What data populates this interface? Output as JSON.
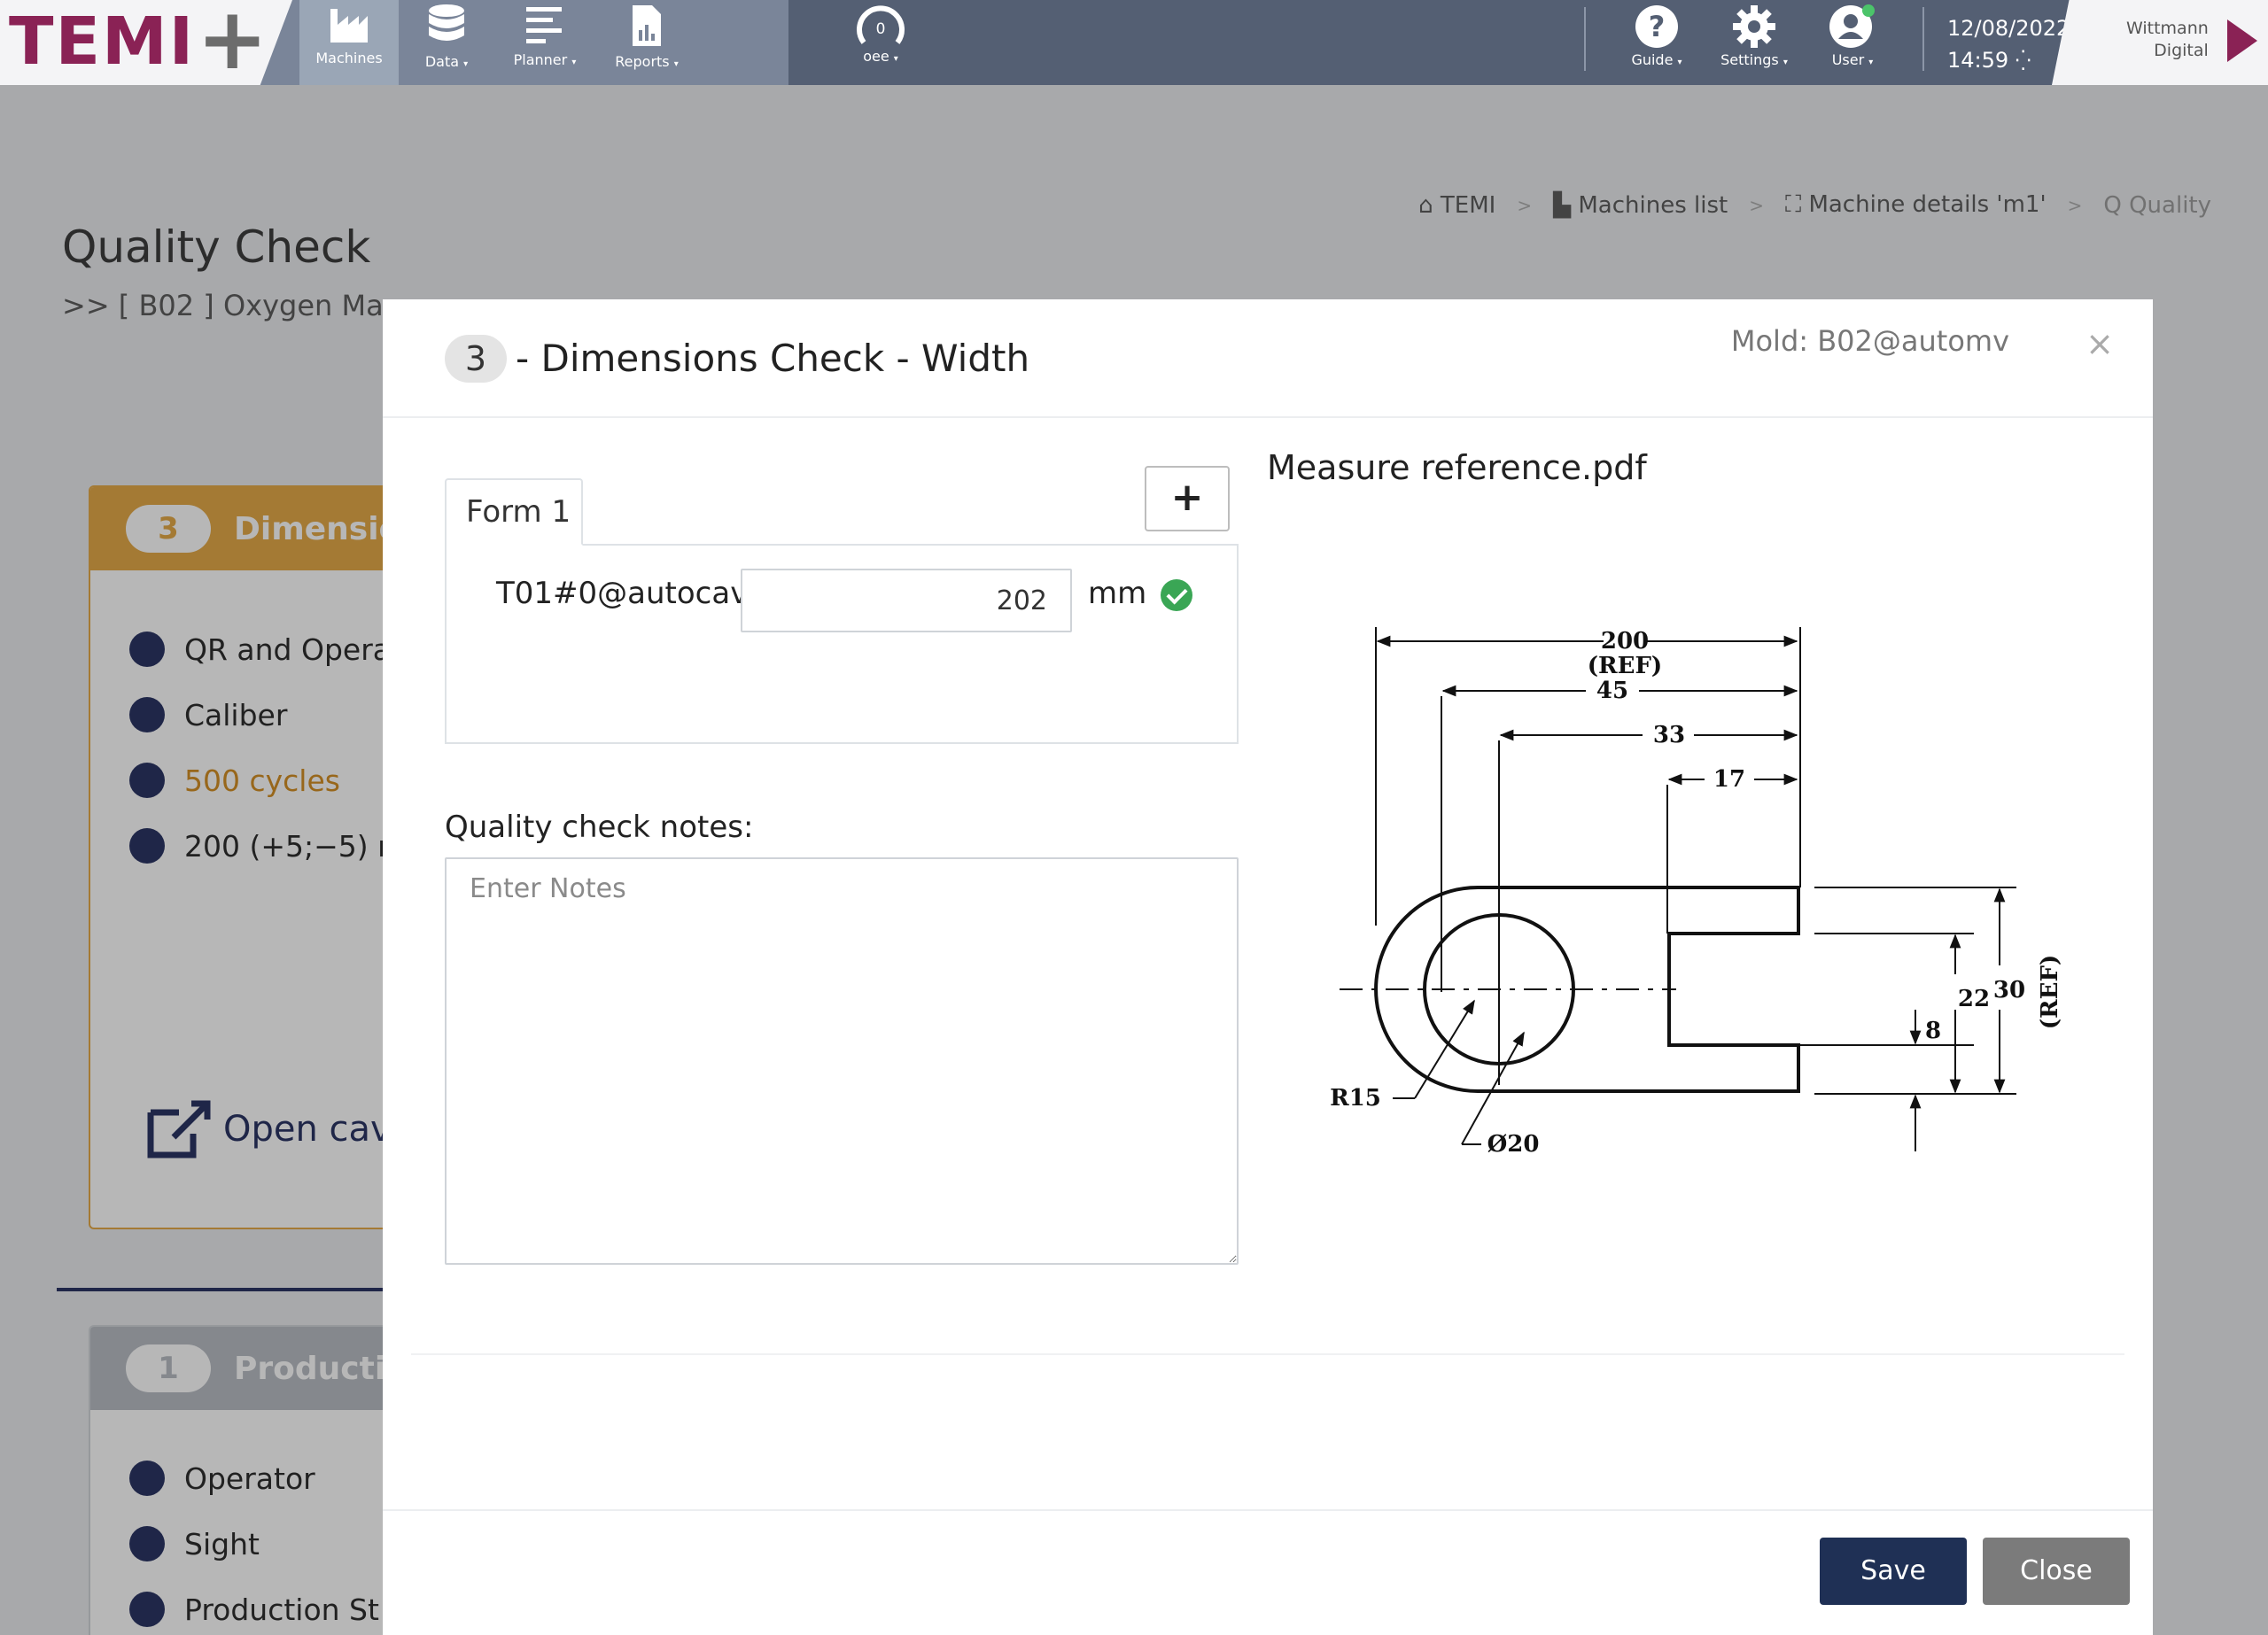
{
  "nav": {
    "items": [
      {
        "label": "Machines",
        "active": true
      },
      {
        "label": "Data"
      },
      {
        "label": "Planner"
      },
      {
        "label": "Reports"
      }
    ],
    "oee": {
      "value": "0",
      "label": "oee"
    },
    "right_items": [
      {
        "label": "Guide"
      },
      {
        "label": "Settings"
      },
      {
        "label": "User"
      }
    ],
    "date": "12/08/2022",
    "time": "14:59",
    "brand_line1": "Wittmann",
    "brand_line2": "Digital",
    "logo_text": "TEMI"
  },
  "breadcrumb": [
    "TEMI",
    "Machines list",
    "Machine details 'm1'",
    "Quality"
  ],
  "page": {
    "title": "Quality Check",
    "subtitle": ">> [ B02 ] Oxygen Mas"
  },
  "cards": [
    {
      "number": "3",
      "title": "Dimension",
      "rows": [
        {
          "icon": "user-circle-icon",
          "text": "QR  and  Opera"
        },
        {
          "icon": "caliper-icon",
          "text": "Caliber"
        },
        {
          "icon": "clock-icon",
          "text": "500  cycles",
          "highlight": true
        },
        {
          "icon": "ruler-icon",
          "text": "200 (+5;−5) mr"
        }
      ],
      "link": "Open cavi"
    },
    {
      "number": "1",
      "title": "Productio",
      "rows": [
        {
          "icon": "user-circle-icon",
          "text": "Operator"
        },
        {
          "icon": "caliper-icon",
          "text": "Sight"
        },
        {
          "icon": "clock-icon",
          "text": "Production  St"
        }
      ]
    }
  ],
  "modal": {
    "step": "3",
    "title": "- Dimensions Check - Width",
    "mold": "Mold: B02@automv",
    "close_glyph": "×",
    "tab_label": "Form 1",
    "add_glyph": "+",
    "field_label": "T01#0@autocav",
    "field_value": "202",
    "unit": "mm",
    "notes_label": "Quality check notes:",
    "notes_placeholder": "Enter Notes",
    "pdf_title": "Measure reference.pdf",
    "save": "Save",
    "close": "Close"
  },
  "drawing_labels": {
    "d200": "200",
    "ref": "(REF)",
    "d45": "45",
    "d33": "33",
    "d17": "17",
    "d30": "30",
    "d22": "22",
    "d8": "8",
    "r15": "R15",
    "dia20": "Ø20"
  },
  "colors": {
    "nav_bg": "#545f73",
    "accent_orange": "#e3a53f",
    "navy": "#1f2a5c",
    "brand": "#8a2255",
    "success": "#3aa655",
    "save_button": "#1f3055",
    "close_button": "#7b7b7b"
  }
}
